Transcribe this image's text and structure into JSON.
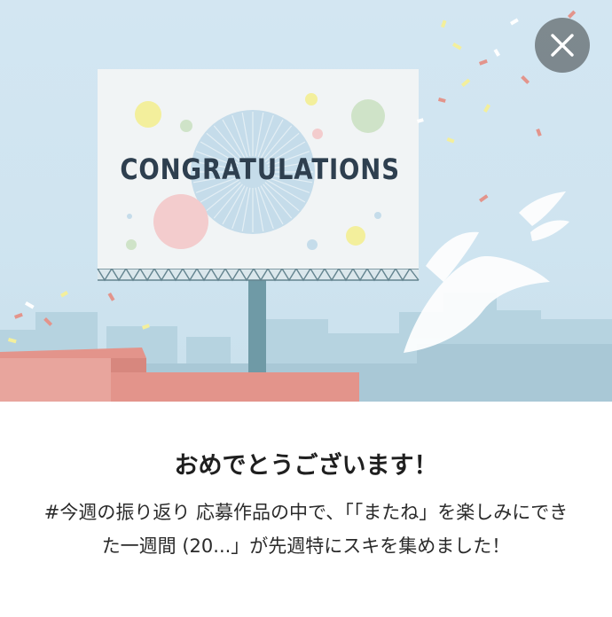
{
  "hero": {
    "billboard_text": "CONGRATULATIONS",
    "close_icon": "close-icon"
  },
  "content": {
    "headline": "おめでとうございます！",
    "message": "#今週の振り返り 応募作品の中で、「「またね」を楽しみにできた一週間 (20...」が先週特にスキを集めました！"
  },
  "colors": {
    "sky": "#d3e6f2",
    "billboard_text": "#2e3f4f",
    "roof": "#e3948b",
    "close_button": "#6e787d"
  }
}
